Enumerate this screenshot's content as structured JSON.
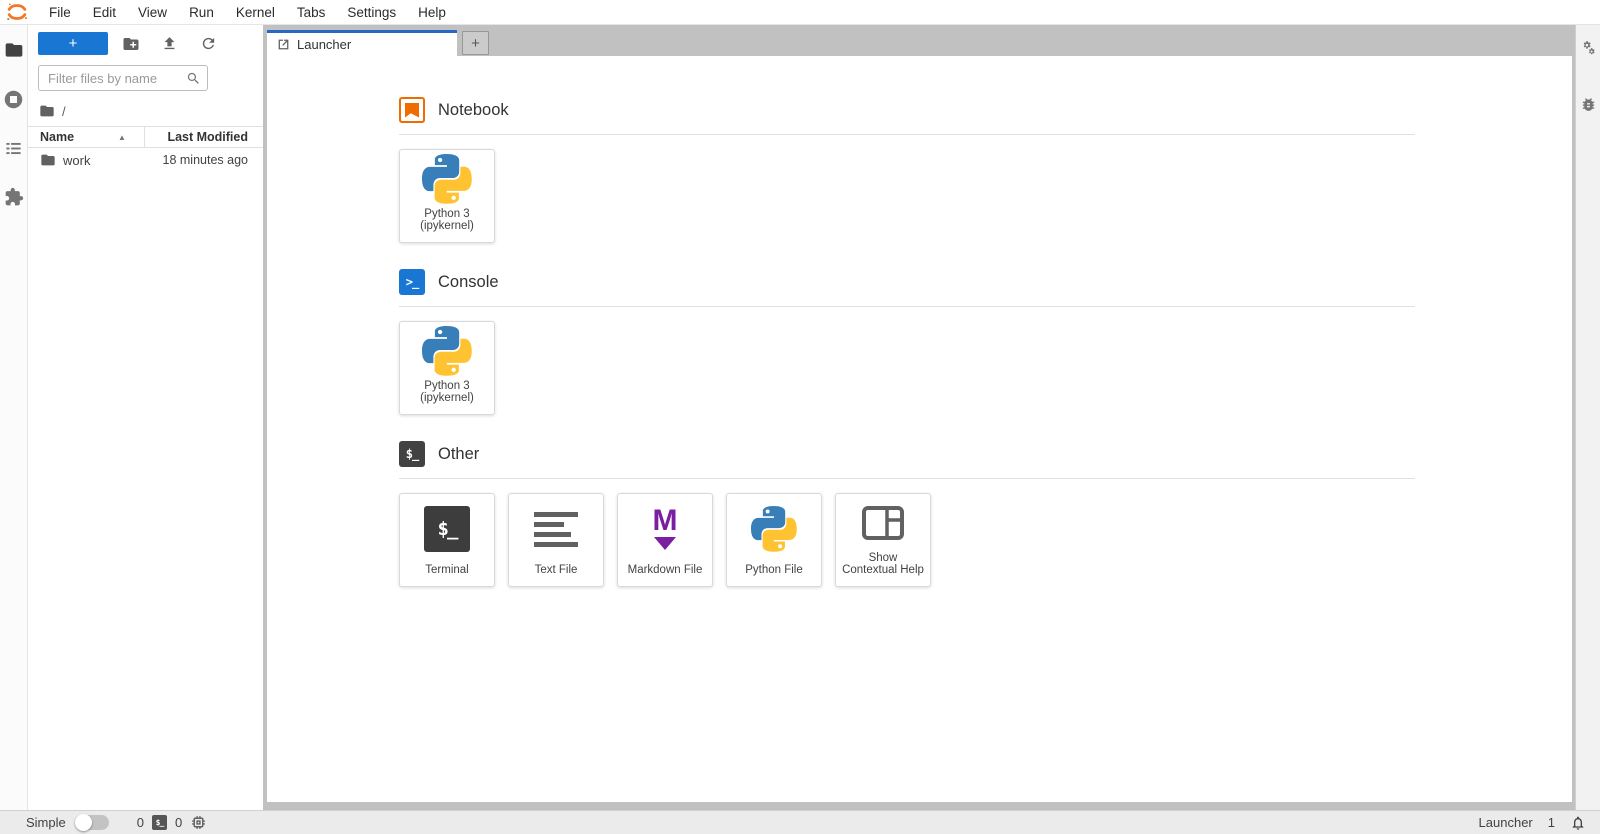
{
  "menu_bar": {
    "items": [
      {
        "label": "File"
      },
      {
        "label": "Edit"
      },
      {
        "label": "View"
      },
      {
        "label": "Run"
      },
      {
        "label": "Kernel"
      },
      {
        "label": "Tabs"
      },
      {
        "label": "Settings"
      },
      {
        "label": "Help"
      }
    ]
  },
  "file_browser": {
    "new_launcher_label": "+",
    "filter_placeholder": "Filter files by name",
    "breadcrumb_root": "/",
    "columns": {
      "name": "Name",
      "last_modified": "Last Modified"
    },
    "sort_indicator": "▲",
    "rows": [
      {
        "name": "work",
        "last_modified": "18 minutes ago"
      }
    ]
  },
  "tab_bar": {
    "active_tab_label": "Launcher",
    "add_tab_label": "+"
  },
  "launcher": {
    "sections": [
      {
        "title": "Notebook",
        "cards": [
          {
            "line1": "Python 3",
            "line2": "(ipykernel)"
          }
        ]
      },
      {
        "title": "Console",
        "cards": [
          {
            "line1": "Python 3",
            "line2": "(ipykernel)"
          }
        ]
      },
      {
        "title": "Other",
        "cards": [
          {
            "line1": "Terminal",
            "line2": ""
          },
          {
            "line1": "Text File",
            "line2": ""
          },
          {
            "line1": "Markdown File",
            "line2": ""
          },
          {
            "line1": "Python File",
            "line2": ""
          },
          {
            "line1": "Show",
            "line2": "Contextual Help"
          }
        ]
      }
    ],
    "console_glyph": ">_",
    "other_glyph": "$_",
    "terminal_glyph": "$_",
    "markdown_glyph": "M"
  },
  "status_bar": {
    "mode_label": "Simple",
    "terminals_count": "0",
    "kernels_count": "0",
    "context_label": "Launcher",
    "notifications_count": "1"
  },
  "colors": {
    "brand_blue": "#1976d2",
    "jupyter_orange": "#f37726",
    "notebook_orange": "#ef6c00",
    "markdown_purple": "#7b1fa2",
    "terminal_dark": "#3d3d3d",
    "icon_gray": "#616161"
  }
}
